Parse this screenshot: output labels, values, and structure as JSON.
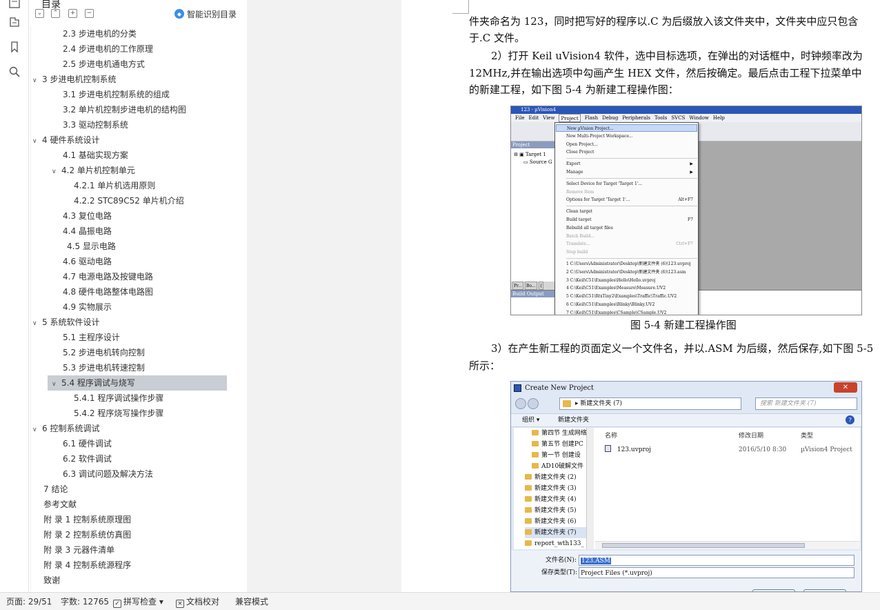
{
  "toc": {
    "title": "目录",
    "ai_button": "智能识别目录",
    "items": [
      {
        "label": "2.3  步进电机的分类",
        "level": 2
      },
      {
        "label": "2.4  步进电机的工作原理",
        "level": 2
      },
      {
        "label": "2.5  步进电机通电方式",
        "level": 2
      },
      {
        "label": "3   步进电机控制系统",
        "level": 1,
        "chevron": true
      },
      {
        "label": "3.1  步进电机控制系统的组成",
        "level": 2
      },
      {
        "label": "3.2 单片机控制步进电机的结构图",
        "level": 2
      },
      {
        "label": "3.3  驱动控制系统",
        "level": 2
      },
      {
        "label": "4   硬件系统设计",
        "level": 1,
        "chevron": true
      },
      {
        "label": "4.1  基础实现方案",
        "level": 2
      },
      {
        "label": "4.2  单片机控制单元",
        "level": 2,
        "chevron": true
      },
      {
        "label": "4.2.1  单片机选用原则",
        "level": 3
      },
      {
        "label": "4.2.2 STC89C52 单片机介绍",
        "level": 3
      },
      {
        "label": "4.3  复位电路",
        "level": 2
      },
      {
        "label": "4.4  晶振电路",
        "level": 2
      },
      {
        "label": "4.5  显示电路",
        "level": 2.5
      },
      {
        "label": "4.6  驱动电路",
        "level": 2
      },
      {
        "label": "4.7  电源电路及按键电路",
        "level": 2
      },
      {
        "label": "4.8  硬件电路整体电路图",
        "level": 2
      },
      {
        "label": "4.9  实物展示",
        "level": 2
      },
      {
        "label": "5   系统软件设计",
        "level": 1,
        "chevron": true
      },
      {
        "label": "5.1  主程序设计",
        "level": 2
      },
      {
        "label": "5.2  步进电机转向控制",
        "level": 2
      },
      {
        "label": "5.3  步进电机转速控制",
        "level": 2
      },
      {
        "label": "5.4  程序调试与烧写",
        "level": 2,
        "chevron": true,
        "active": true
      },
      {
        "label": "5.4.1  程序调试操作步骤",
        "level": 3
      },
      {
        "label": "5.4.2  程序烧写操作步骤",
        "level": 3
      },
      {
        "label": "6   控制系统调试",
        "level": 1,
        "chevron": true
      },
      {
        "label": "6.1  硬件调试",
        "level": 2
      },
      {
        "label": "6.2  软件调试",
        "level": 2
      },
      {
        "label": "6.3  调试问题及解决方法",
        "level": 2
      },
      {
        "label": "7   结论",
        "level": 1
      },
      {
        "label": "参考文献",
        "level": 1
      },
      {
        "label": "附   录 1  控制系统原理图",
        "level": 1
      },
      {
        "label": "附   录 2  控制系统仿真图",
        "level": 1
      },
      {
        "label": "附   录 3  元器件清单",
        "level": 1
      },
      {
        "label": "附   录 4  控制系统源程序",
        "level": 1
      },
      {
        "label": "致谢",
        "level": 1
      }
    ]
  },
  "document": {
    "p1_line1": "件夹命名为 123，同时把写好的程序以.C 为后缀放入该文件夹中，文件夹中应只包含",
    "p1_line2": "于.C 文件。",
    "p2_line1": "2）打开 Keil uVision4 软件，选中目标选项，在弹出的对话框中，时钟频率改为",
    "p2_line2": "12MHz,并在输出选项中勾画产生 HEX 文件，然后按确定。最后点击工程下拉菜单中",
    "p2_line3": "的新建工程，如下图 5-4 为新建工程操作图：",
    "caption1": "图 5-4  新建工程操作图",
    "p3_line1": "3）在产生新工程的页面定义一个文件名，并以.ASM 为后缀，然后保存,如下图 5-5",
    "p3_line2": "所示："
  },
  "fig1": {
    "window_title": "123 - µVision4",
    "menus": [
      "File",
      "Edit",
      "View",
      "Project",
      "Flash",
      "Debug",
      "Peripherals",
      "Tools",
      "SVCS",
      "Window",
      "Help"
    ],
    "project_panel": "Project",
    "tree_target": "Target 1",
    "tree_group": "Source G",
    "tabs": [
      "Pr...",
      "Bo...",
      "{"
    ],
    "build_output": "Build Output",
    "menu_items": [
      {
        "label": "New µVision Project...",
        "hl": true
      },
      {
        "label": "New Multi-Project Workspace..."
      },
      {
        "label": "Open Project..."
      },
      {
        "label": "Close Project"
      },
      {
        "sep": true
      },
      {
        "label": "Export",
        "arrow": true
      },
      {
        "label": "Manage",
        "arrow": true
      },
      {
        "sep": true
      },
      {
        "label": "Select Device for Target 'Target 1'..."
      },
      {
        "label": "Remove Item",
        "dis": true
      },
      {
        "label": "Options for Target 'Target 1'...",
        "sc": "Alt+F7"
      },
      {
        "sep": true
      },
      {
        "label": "Clean target"
      },
      {
        "label": "Build target",
        "sc": "F7"
      },
      {
        "label": "Rebuild all target files"
      },
      {
        "label": "Batch Build...",
        "dis": true
      },
      {
        "label": "Translate...",
        "dis": true,
        "sc": "Ctrl+F7"
      },
      {
        "label": "Stop build",
        "dis": true
      },
      {
        "sep": true
      },
      {
        "label": "1 C:\\Users\\Administrator\\Desktop\\新建文件夹 (6)\\123.uvproj"
      },
      {
        "label": "2 C:\\Users\\Administrator\\Desktop\\新建文件夹 (6)\\123.asm"
      },
      {
        "label": "3 C:\\Keil\\C51\\Examples\\Hello\\Hello.uvproj"
      },
      {
        "label": "4 C:\\Keil\\C51\\Examples\\Measure\\Measure.UV2"
      },
      {
        "label": "5 C:\\Keil\\C51\\RtxTiny2\\Examples\\Traffic\\Traffic.UV2"
      },
      {
        "label": "6 C:\\Keil\\C51\\Examples\\Blinky\\Blinky.UV2"
      },
      {
        "label": "7 C:\\Keil\\C51\\Examples\\CSample\\CSample.UV2"
      }
    ]
  },
  "fig2": {
    "window_title": "Create New Project",
    "close": "✕",
    "path": "新建文件夹 (7)",
    "search": "搜索 新建文件夹 (7)",
    "organize": "组织 ▾",
    "new_folder": "新建文件夹",
    "nav_items": [
      "第四节 生成网络",
      "第五节 创建PC",
      "第一节 创建设",
      "AD10破解文件",
      "新建文件夹 (2)",
      "新建文件夹 (3)",
      "新建文件夹 (4)",
      "新建文件夹 (5)",
      "新建文件夹 (6)",
      "新建文件夹 (7)",
      "report_wth133_"
    ],
    "col_name": "名称",
    "col_date": "修改日期",
    "col_type": "类型",
    "file_name": "123.uvproj",
    "file_date": "2016/5/10 8:30",
    "file_type": "µVision4 Project",
    "filename_label": "文件名(N):",
    "filename_value": "123.ASM",
    "filetype_label": "保存类型(T):",
    "filetype_value": "Project Files (*.uvproj)"
  },
  "status": {
    "page": "页面: 29/51",
    "words": "字数: 12765",
    "spell": "拼写检查",
    "proof": "文档校对",
    "compat": "兼容模式"
  }
}
